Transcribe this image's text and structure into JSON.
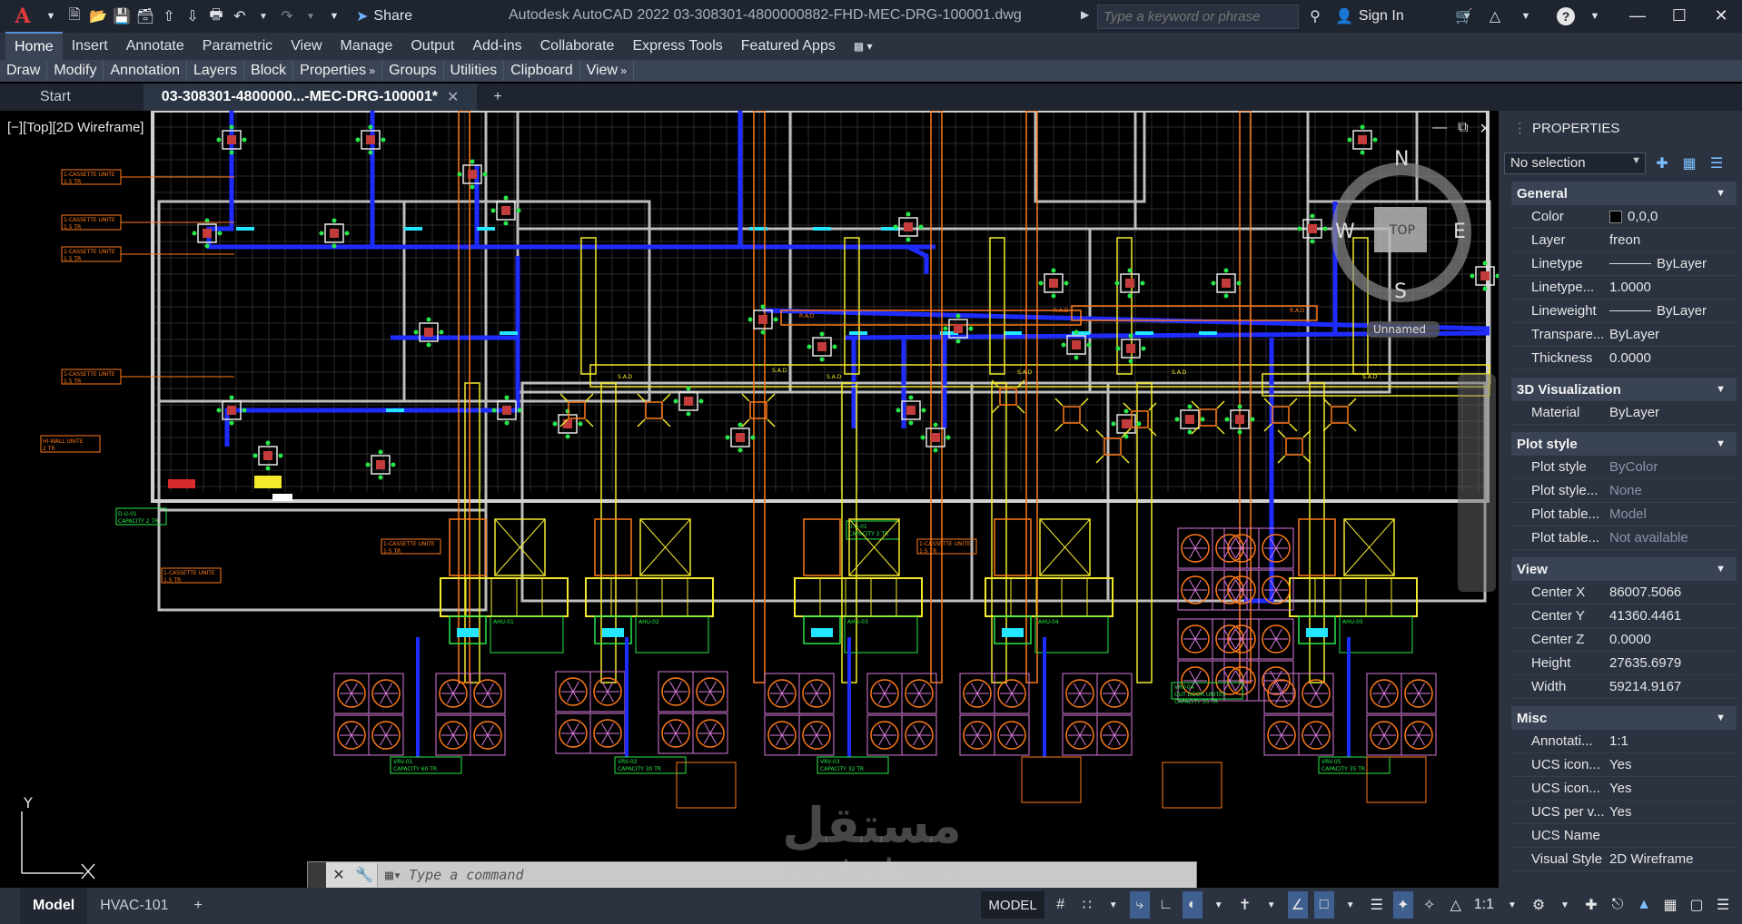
{
  "app": {
    "title": "Autodesk AutoCAD 2022    03-308301-4800000882-FHD-MEC-DRG-100001.dwg",
    "share_label": "Share",
    "search_placeholder": "Type a keyword or phrase",
    "signin_label": "Sign In"
  },
  "ribbon": {
    "tabs": [
      "Home",
      "Insert",
      "Annotate",
      "Parametric",
      "View",
      "Manage",
      "Output",
      "Add-ins",
      "Collaborate",
      "Express Tools",
      "Featured Apps"
    ],
    "panels": [
      "Draw",
      "Modify",
      "Annotation",
      "Layers",
      "Block",
      "Properties",
      "Groups",
      "Utilities",
      "Clipboard",
      "View"
    ]
  },
  "doc_tabs": {
    "start": "Start",
    "active": "03-308301-4800000...-MEC-DRG-100001*"
  },
  "viewport": {
    "label": "[−][Top][2D Wireframe]",
    "viewcube": {
      "top": "TOP",
      "n": "N",
      "s": "S",
      "e": "E",
      "w": "W",
      "ucs": "Unnamed"
    },
    "ucs_y": "Y"
  },
  "drawing_labels": {
    "cassette_unit": "1-CASSETTE UNITE\n1.5 TR",
    "wall_unit": "HI-WALL UNITE\n2 TR",
    "du_01": "D.U-01\nCAPACITY 2 TR",
    "ahu_1": "AHU-01",
    "ahu_2": "AHU-02",
    "ahu_3": "AHU-03",
    "ahu_4": "AHU-04",
    "ahu_5": "AHU-05",
    "vrv_1": "VRV-01\nCAPACITY 60 TR",
    "vrv_2": "VRV-02\nCAPACITY 30 TR",
    "vrv_3": "VRV-03\nCAPACITY 32 TR",
    "vrv_4": "VRV-05\nCAPACITY 35 TR",
    "vrv_5": "VRV-04\nOUT DOOR UNITES\nCAPACITY 35 TR",
    "sad_label": "S.A.D",
    "rad_label": "R.A.D"
  },
  "properties": {
    "title": "PROPERTIES",
    "selection": "No selection",
    "sections": [
      {
        "name": "General",
        "rows": [
          {
            "k": "Color",
            "v": "0,0,0"
          },
          {
            "k": "Layer",
            "v": "freon"
          },
          {
            "k": "Linetype",
            "v": "ByLayer"
          },
          {
            "k": "Linetype...",
            "v": "1.0000"
          },
          {
            "k": "Lineweight",
            "v": "ByLayer"
          },
          {
            "k": "Transpare...",
            "v": "ByLayer"
          },
          {
            "k": "Thickness",
            "v": "0.0000"
          }
        ]
      },
      {
        "name": "3D Visualization",
        "rows": [
          {
            "k": "Material",
            "v": "ByLayer"
          }
        ]
      },
      {
        "name": "Plot style",
        "rows": [
          {
            "k": "Plot style",
            "v": "ByColor"
          },
          {
            "k": "Plot style...",
            "v": "None"
          },
          {
            "k": "Plot table...",
            "v": "Model"
          },
          {
            "k": "Plot table...",
            "v": "Not available"
          }
        ]
      },
      {
        "name": "View",
        "rows": [
          {
            "k": "Center X",
            "v": "86007.5066"
          },
          {
            "k": "Center Y",
            "v": "41360.4461"
          },
          {
            "k": "Center Z",
            "v": "0.0000"
          },
          {
            "k": "Height",
            "v": "27635.6979"
          },
          {
            "k": "Width",
            "v": "59214.9167"
          }
        ]
      },
      {
        "name": "Misc",
        "rows": [
          {
            "k": "Annotati...",
            "v": "1:1"
          },
          {
            "k": "UCS icon...",
            "v": "Yes"
          },
          {
            "k": "UCS icon...",
            "v": "Yes"
          },
          {
            "k": "UCS per v...",
            "v": "Yes"
          },
          {
            "k": "UCS Name",
            "v": ""
          },
          {
            "k": "Visual Style",
            "v": "2D Wireframe"
          }
        ]
      }
    ]
  },
  "command": {
    "placeholder": "Type a command"
  },
  "status": {
    "layout_tabs": [
      "Model",
      "HVAC-101"
    ],
    "model_label": "MODEL",
    "scale": "1:1"
  },
  "watermark": {
    "arabic": "مستقل",
    "latin": "mostaql.com"
  },
  "colors": {
    "duct_blue": "#1f2cff",
    "yellow": "#f2ea2a",
    "orange": "#ff7a1a",
    "green": "#27e84a",
    "magenta": "#d87adc",
    "cyan": "#25e6ff",
    "grid_white": "#9a9a9a"
  }
}
